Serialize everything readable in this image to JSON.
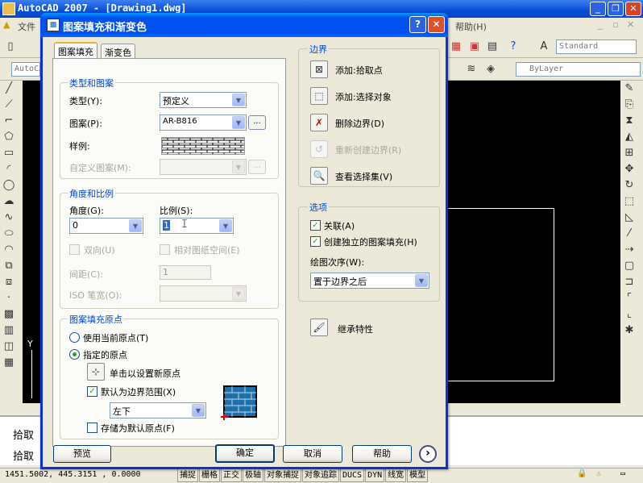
{
  "app": {
    "title": "AutoCAD 2007 - [Drawing1.dwg]",
    "menu_first": "文件",
    "menu_help": "帮助",
    "menu_help_key": "(H)",
    "style_combo": "Standard",
    "layer_combo": "ByLayer",
    "workspace_combo": "AutoCA"
  },
  "drawing": {
    "y_axis_label": "Y"
  },
  "command": {
    "line1": "拾取",
    "line2": "拾取"
  },
  "status": {
    "coords": "1451.5002, 445.3151 , 0.0000",
    "toggles": [
      "捕捉",
      "栅格",
      "正交",
      "极轴",
      "对象捕捉",
      "对象追踪",
      "DUCS",
      "DYN",
      "线宽",
      "模型"
    ]
  },
  "dialog": {
    "title": "图案填充和渐变色",
    "help_btn": "?",
    "close_btn": "✕",
    "tabs": [
      "图案填充",
      "渐变色"
    ],
    "type_group": {
      "title": "类型和图案",
      "type_label": "类型(Y):",
      "type_value": "预定义",
      "pattern_label": "图案(P):",
      "pattern_value": "AR-B816",
      "pattern_browse": "...",
      "sample_label": "样例:",
      "custom_label": "自定义图案(M):",
      "custom_browse": "..."
    },
    "angle_group": {
      "title": "角度和比例",
      "angle_label": "角度(G):",
      "angle_value": "0",
      "scale_label": "比例(S):",
      "scale_value": "1",
      "double_label": "双向(U)",
      "relative_label": "相对图纸空间(E)",
      "spacing_label": "间距(C):",
      "spacing_value": "1",
      "iso_label": "ISO 笔宽(O):"
    },
    "origin_group": {
      "title": "图案填充原点",
      "use_current": "使用当前原点(T)",
      "specified": "指定的原点",
      "click_set": "单击以设置新原点",
      "default_boundary": "默认为边界范围(X)",
      "position_value": "左下",
      "store_default": "存储为默认原点(F)"
    },
    "boundary_group": {
      "title": "边界",
      "add_pick": "添加:拾取点",
      "add_select": "添加:选择对象",
      "remove": "删除边界(D)",
      "recreate": "重新创建边界(R)",
      "view_select": "查看选择集(V)"
    },
    "options_group": {
      "title": "选项",
      "associative": "关联(A)",
      "independent": "创建独立的图案填充(H)",
      "draw_order_label": "绘图次序(W):",
      "draw_order_value": "置于边界之后"
    },
    "inherit": "继承特性",
    "buttons": {
      "preview": "预览",
      "ok": "确定",
      "cancel": "取消",
      "help": "帮助",
      "more": "›"
    }
  }
}
